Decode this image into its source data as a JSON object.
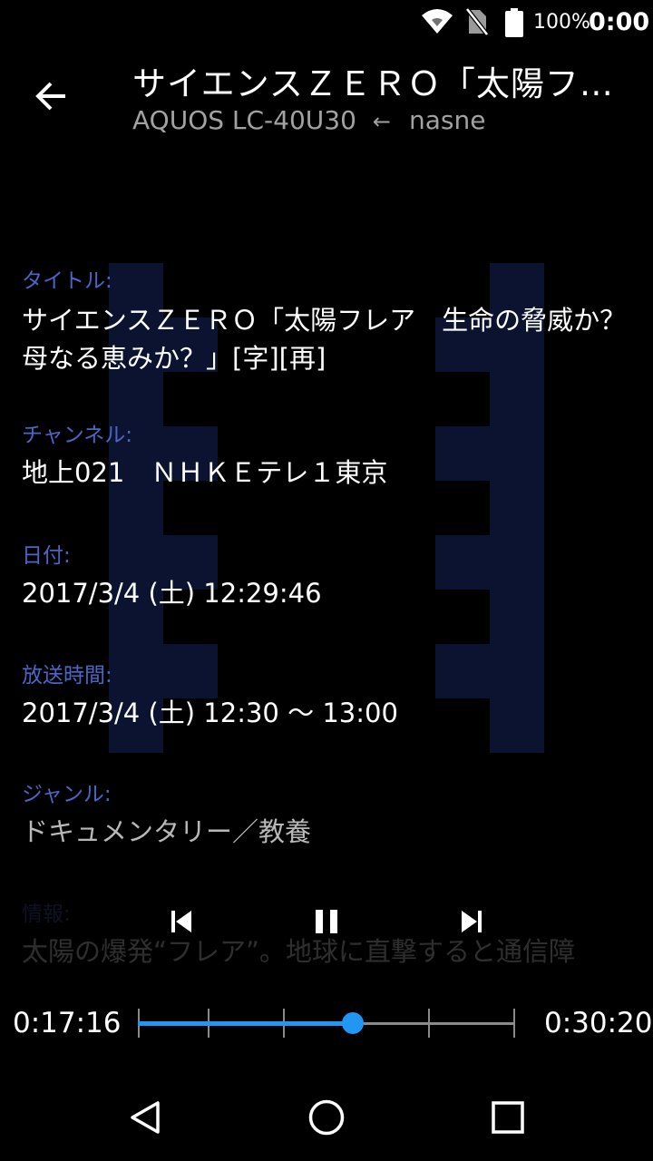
{
  "status_bar": {
    "battery_percent": "100%",
    "time": "0:00",
    "icons": [
      "wifi-icon",
      "no-sim-icon",
      "battery-icon"
    ]
  },
  "header": {
    "title": "サイエンスＺＥＲＯ「太陽フレア　生命の脅威か？母なる恵みか？」[字][再]",
    "device": "AQUOS LC-40U30",
    "arrow": "←",
    "source": "nasne"
  },
  "details": [
    {
      "label": "タイトル:",
      "value": "サイエンスＺＥＲＯ「太陽フレア　生命の脅威か？母なる恵みか？」[字][再]"
    },
    {
      "label": "チャンネル:",
      "value": "地上021　ＮＨＫＥテレ１東京"
    },
    {
      "label": "日付:",
      "value": "2017/3/4 (土) 12:29:46"
    },
    {
      "label": "放送時間:",
      "value": "2017/3/4 (土) 12:30 〜 13:00"
    },
    {
      "label": "ジャンル:",
      "value": "ドキュメンタリー／教養"
    },
    {
      "label": "情報:",
      "value": "太陽の爆発“フレア”。地球に直撃すると通信障"
    }
  ],
  "player": {
    "elapsed": "0:17:16",
    "total": "0:30:20",
    "progress": 0.569,
    "chapter_marks": [
      0.0,
      0.185,
      0.385,
      0.77,
      1.0
    ],
    "accent_color": "#2196f3"
  },
  "nav": [
    "back-triangle-icon",
    "home-circle-icon",
    "recents-square-icon"
  ]
}
